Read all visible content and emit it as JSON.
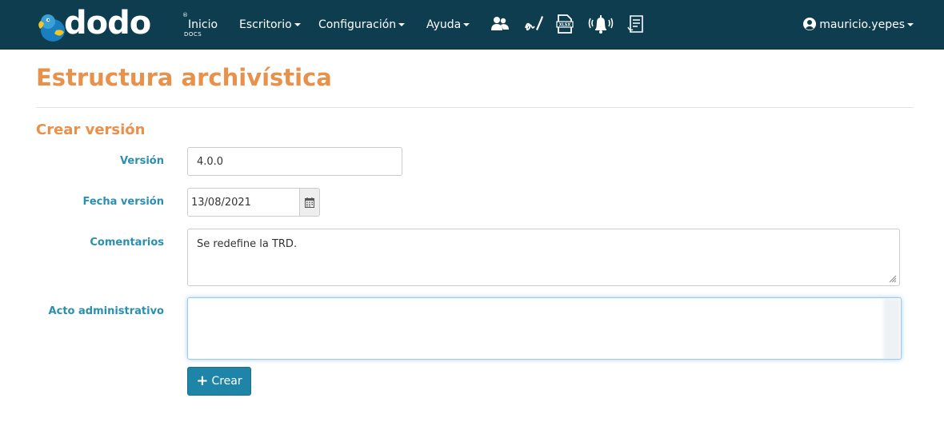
{
  "app": {
    "brand_word": "dodo",
    "brand_sub": "DOCS",
    "brand_reg": "®"
  },
  "nav": {
    "items": [
      {
        "label": "Inicio",
        "dropdown": false
      },
      {
        "label": "Escritorio",
        "dropdown": true
      },
      {
        "label": "Configuración",
        "dropdown": true
      },
      {
        "label": "Ayuda",
        "dropdown": true
      }
    ],
    "icons": [
      "users-icon",
      "signature-icon",
      "xlsx-file-icon",
      "bell-icon",
      "document-list-icon"
    ],
    "user": "mauricio.yepes"
  },
  "page": {
    "title": "Estructura archivística",
    "section": "Crear versión"
  },
  "form": {
    "version_label": "Versión",
    "version_value": "4.0.0",
    "fecha_label": "Fecha versión",
    "fecha_value": "13/08/2021",
    "comentarios_label": "Comentarios",
    "comentarios_value": "Se redefine la TRD.",
    "acto_label": "Acto administrativo",
    "acto_value": "",
    "submit_label": "Crear"
  },
  "colors": {
    "navbar": "#0d3d4f",
    "accent_orange": "#e8914a",
    "label_blue": "#2a8fb0",
    "button": "#1f85a8"
  }
}
